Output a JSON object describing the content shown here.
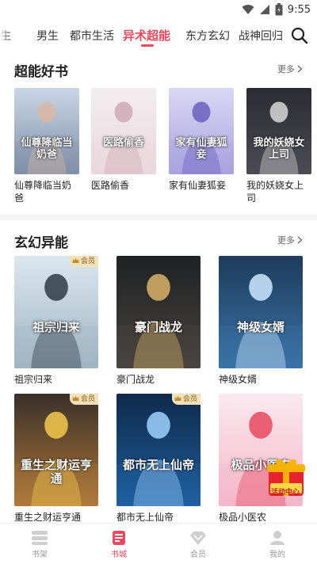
{
  "status_bar": {
    "time": "9:55",
    "icons": [
      "wifi-icon",
      "cell-signal-icon",
      "battery-icon"
    ]
  },
  "tabs": [
    {
      "label": "女生",
      "active": false
    },
    {
      "label": "男生",
      "active": false
    },
    {
      "label": "都市生活",
      "active": false
    },
    {
      "label": "异术超能",
      "active": true
    },
    {
      "label": "东方玄幻",
      "active": false
    },
    {
      "label": "战神回归",
      "active": false
    }
  ],
  "sections": [
    {
      "title": "超能好书",
      "more": "更多",
      "books": [
        {
          "title": "仙尊降临当奶爸",
          "cover_text": "仙尊降临当奶爸",
          "palette": [
            "#c9d6e6",
            "#7f8fa8",
            "#d9b6a3"
          ]
        },
        {
          "title": "医路偷香",
          "cover_text": "医路偷香",
          "palette": [
            "#f3eef0",
            "#e9d7dd",
            "#d0a9b6"
          ]
        },
        {
          "title": "家有仙妻狐妾",
          "cover_text": "家有仙妻狐妾",
          "palette": [
            "#d9d7f3",
            "#a9a2de",
            "#6a5fc0"
          ]
        },
        {
          "title": "我的妖娆女上司",
          "cover_text": "我的妖娆女上司",
          "palette": [
            "#2b2b33",
            "#4a4a55",
            "#d8d8d8"
          ]
        }
      ]
    },
    {
      "title": "玄幻异能",
      "more": "更多",
      "books": [
        {
          "title": "祖宗归来",
          "cover_text": "祖宗归来",
          "vip": "会员",
          "palette": [
            "#dce7ef",
            "#9fb4c3",
            "#2f3b44"
          ]
        },
        {
          "title": "豪门战龙",
          "cover_text": "豪门战龙",
          "vip": "",
          "palette": [
            "#1f2124",
            "#4a4540",
            "#d9b36a"
          ]
        },
        {
          "title": "神级女婿",
          "cover_text": "神级女婿",
          "vip": "",
          "palette": [
            "#1e3c5c",
            "#3a74a8",
            "#cfe8ff"
          ]
        },
        {
          "title": "重生之财运亨通",
          "cover_text": "重生之财运亨通",
          "vip": "会员",
          "palette": [
            "#3a2f2a",
            "#b07a3a",
            "#f2c94c"
          ]
        },
        {
          "title": "都市无上仙帝",
          "cover_text": "都市无上仙帝",
          "vip": "会员",
          "palette": [
            "#0e2a4a",
            "#1f5fa0",
            "#9fd2ff"
          ]
        },
        {
          "title": "极品小医农",
          "cover_text": "极品小医农",
          "vip": "",
          "palette": [
            "#fbe9ef",
            "#f3b7c9",
            "#e8495e"
          ]
        }
      ]
    }
  ],
  "activity": {
    "label": "活动中心"
  },
  "bottom_nav": [
    {
      "label": "书架",
      "icon": "bookshelf-icon",
      "active": false
    },
    {
      "label": "书城",
      "icon": "bookstore-icon",
      "active": true
    },
    {
      "label": "会员",
      "icon": "member-diamond-icon",
      "active": false
    },
    {
      "label": "我的",
      "icon": "profile-icon",
      "active": false
    }
  ],
  "colors": {
    "accent": "#e8495e",
    "text": "#222222",
    "muted": "#999999"
  }
}
